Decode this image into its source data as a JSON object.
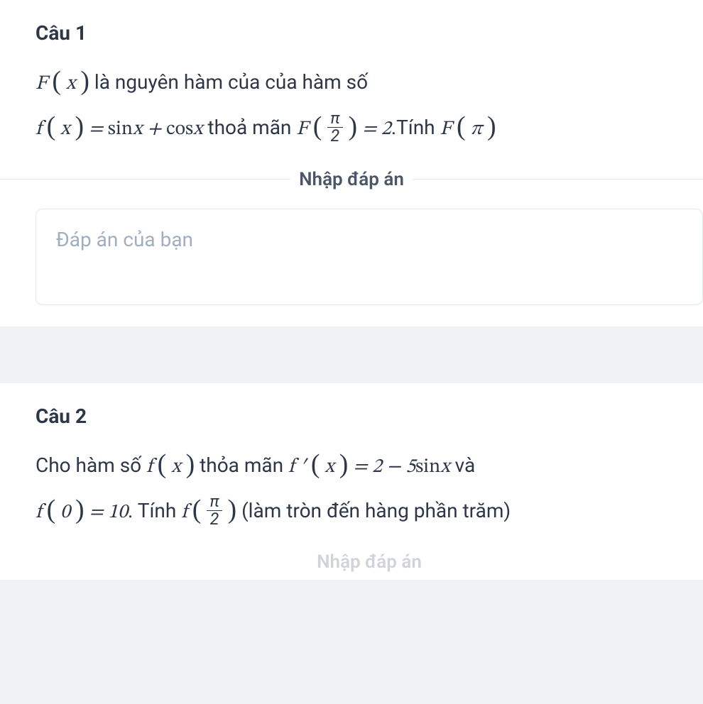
{
  "q1": {
    "title": "Câu 1",
    "line1_pre": "F",
    "line1_paren_open": "(",
    "line1_x": "x",
    "line1_paren_close": ")",
    "line1_text1": " là nguyên hàm của của hàm số",
    "line2_f": "f",
    "line2_po": "(",
    "line2_x": "x",
    "line2_pc": ")",
    "line2_eq1": " = ",
    "line2_sin": "sin",
    "line2_sx": "x",
    "line2_plus": " + ",
    "line2_cos": "cos",
    "line2_cx": "x",
    "line2_text2": " thoả mãn ",
    "line2_F2": "F",
    "line2_frac_n": "π",
    "line2_frac_d": "2",
    "line2_eq2": " = 2",
    "line2_text3": ".Tính ",
    "line2_F3": "F",
    "line2_pi": "π",
    "divider": "Nhập đáp án",
    "placeholder": "Đáp án của bạn"
  },
  "q2": {
    "title": "Câu 2",
    "l1_t1": "Cho hàm số ",
    "l1_f": "f",
    "l1_po": "(",
    "l1_x": "x",
    "l1_pc": ")",
    "l1_t2": " thỏa mãn ",
    "l1_fp": "f ′",
    "l1_po2": "(",
    "l1_x2": "x",
    "l1_pc2": ")",
    "l1_eq": " = 2 − 5",
    "l1_sin": "sin",
    "l1_sx": "x",
    "l1_t3": " và",
    "l2_f": "f",
    "l2_po": "(",
    "l2_0": "0",
    "l2_pc": ")",
    "l2_eq": " = 10",
    "l2_t1": ". Tính ",
    "l2_f2": "f",
    "l2_frac_n": "π",
    "l2_frac_d": "2",
    "l2_t2": " (làm tròn đến hàng phần trăm)",
    "bottom_hint": "Nhập đáp án"
  }
}
